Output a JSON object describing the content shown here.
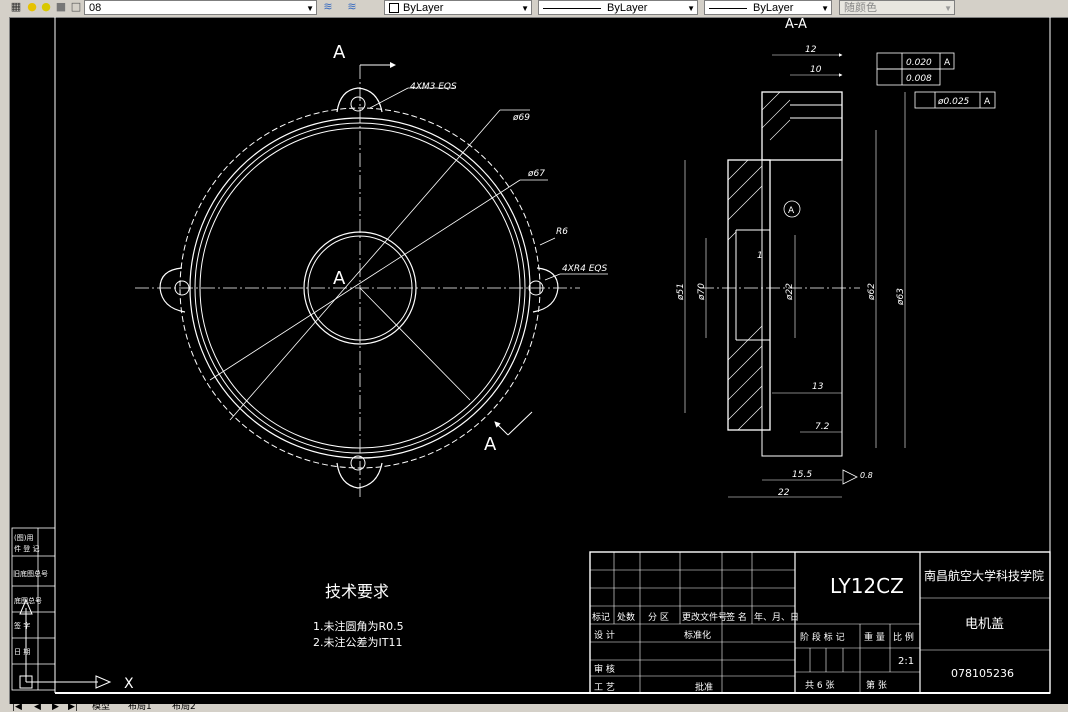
{
  "toolbar": {
    "layer_name": "08",
    "color": "ByLayer",
    "linetype": "ByLayer",
    "lineweight": "ByLayer",
    "plot_style": "随颜色"
  },
  "tabs": {
    "model": "模型",
    "layout1": "布局1",
    "layout2": "布局2"
  },
  "drawing": {
    "section_label": "A-A",
    "section_marker": "A",
    "datum": "A",
    "hole_callout": "4XM3 EQS",
    "dia_69": "ø69",
    "dia_67": "ø67",
    "radius_6": "R6",
    "radius_callout": "4XR4 EQS",
    "dim_12": "12",
    "dim_10": "10",
    "dim_1": "1",
    "dim_13": "13",
    "dim_7_2": "7.2",
    "dim_15_5": "15.5",
    "dim_22": "22",
    "dia_51": "ø51",
    "dia_70": "ø70",
    "dia_22": "ø22",
    "dia_62": "ø62",
    "dia_63": "ø63",
    "tol_1": "0.020",
    "tol_2": "0.008",
    "tol_3": "ø0.025",
    "roughness": "0.8",
    "tech_req_title": "技术要求",
    "tech_req_1": "1.未注圆角为R0.5",
    "tech_req_2": "2.未注公差为IT11",
    "axis_x": "X"
  },
  "title_block": {
    "material": "LY12CZ",
    "school": "南昌航空大学科技学院",
    "part_name": "电机盖",
    "drawing_no": "078105236",
    "scale": "2:1",
    "sheets": "共 6 张",
    "sheet_no": "第 张",
    "row_labels": [
      "标记",
      "处数",
      "分 区",
      "更改文件号",
      "签 名",
      "年、月、日"
    ],
    "design": "设 计",
    "standardize": "标准化",
    "review": "审 核",
    "process": "工 艺",
    "approve": "批准",
    "stage_mark": "阶 段 标 记",
    "weight": "重 量",
    "scale_label": "比 例"
  },
  "side_block": {
    "labels": [
      "(图)用",
      "件 登 记",
      "旧底图总号",
      "底图总号",
      "签 字",
      "日 期"
    ]
  }
}
